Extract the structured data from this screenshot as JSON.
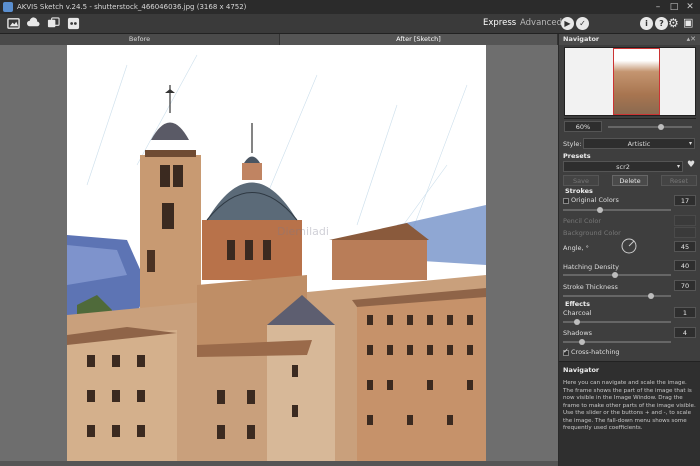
{
  "window": {
    "title": "AKVIS Sketch v.24.5 - shutterstock_466046036.jpg (3168 x 4752)"
  },
  "toolbar": {
    "left_icons": [
      "open-icon",
      "upload-icon",
      "batch-icon",
      "share-icon"
    ],
    "mode_express": "Express",
    "mode_advanced": "Advanced",
    "right_icons": [
      "info-icon",
      "help-icon",
      "settings-icon",
      "feedback-icon"
    ]
  },
  "view_tabs": {
    "before": "Before",
    "after": "After [Sketch]"
  },
  "canvas": {
    "watermark": "Diemiladi"
  },
  "navigator": {
    "title": "Navigator",
    "zoom": "60%",
    "zoom_level": 0.6
  },
  "style": {
    "label": "Style:",
    "value": "Artistic"
  },
  "presets": {
    "title": "Presets",
    "current": "scr2",
    "buttons": {
      "save": "Save",
      "delete": "Delete",
      "reset": "Reset"
    }
  },
  "strokes": {
    "title": "Strokes",
    "original_colors": {
      "label": "Original Colors",
      "value": "17"
    },
    "pencil_color": "Pencil Color",
    "background_color": "Background Color",
    "angle": {
      "label": "Angle, °",
      "value": "45"
    },
    "hatching_density": {
      "label": "Hatching Density",
      "value": "40"
    },
    "stroke_thickness": {
      "label": "Stroke Thickness",
      "value": "70"
    }
  },
  "effects": {
    "title": "Effects",
    "charcoal": {
      "label": "Charcoal",
      "value": "1"
    },
    "shadows": {
      "label": "Shadows",
      "value": "4"
    },
    "cross_hatching": {
      "label": "Cross-hatching",
      "checked": true
    }
  },
  "help": {
    "title": "Navigator",
    "text": "Here you can navigate and scale the image. The frame shows the part of the image that is now visible in the Image Window. Drag the frame to make other parts of the image visible. Use the slider or the buttons + and -, to scale the image. The fall-down menu shows some frequently used coefficients."
  }
}
